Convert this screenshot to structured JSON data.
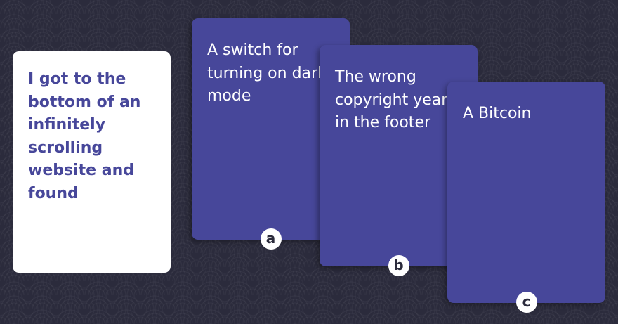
{
  "prompt_card": {
    "text": "I got to the bottom of an infinitely scrolling website and found"
  },
  "answer_cards": [
    {
      "text": "A switch for turning on dark mode",
      "badge": "a"
    },
    {
      "text": "The wrong copyright year in the footer",
      "badge": "b"
    },
    {
      "text": "A Bitcoin",
      "badge": "c"
    }
  ],
  "colors": {
    "background": "#2b2b3c",
    "card_purple": "#47479a",
    "prompt_card_bg": "#ffffff",
    "prompt_text": "#47479a"
  }
}
